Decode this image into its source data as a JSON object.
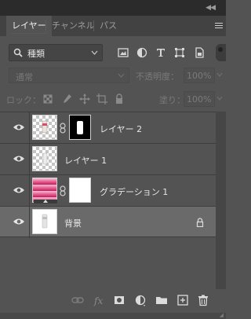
{
  "tabs": [
    {
      "label": "レイヤー",
      "active": true
    },
    {
      "label": "チャンネル",
      "active": false
    },
    {
      "label": "パス",
      "active": false
    }
  ],
  "filter": {
    "kind_label": "種類"
  },
  "blend": {
    "mode": "通常",
    "opacity_label": "不透明度：",
    "opacity_value": "100%"
  },
  "lock": {
    "label": "ロック：",
    "fill_label": "塗り：",
    "fill_value": "100%"
  },
  "layers": [
    {
      "name": "レイヤー 2",
      "thumb": "transparent",
      "has_mask": true,
      "mask": "black"
    },
    {
      "name": "レイヤー 1",
      "thumb": "transparent",
      "has_mask": false
    },
    {
      "name": "グラデーション 1",
      "thumb": "gradient",
      "has_mask": true,
      "mask": "white"
    },
    {
      "name": "背景",
      "thumb": "white",
      "locked": true,
      "selected": true
    }
  ],
  "icons": {
    "filter": [
      "image-filter-icon",
      "adjustment-filter-icon",
      "type-filter-icon",
      "shape-filter-icon",
      "smartobject-filter-icon"
    ],
    "lock": [
      "lock-transparent-icon",
      "lock-image-icon",
      "lock-position-icon",
      "lock-artboard-icon",
      "lock-all-icon"
    ],
    "bottom": [
      "link-layers-icon",
      "fx-icon",
      "add-mask-icon",
      "adjustment-layer-icon",
      "new-group-icon",
      "new-layer-icon",
      "delete-icon"
    ]
  },
  "colors": {
    "panel_bg": "#535353",
    "selected_row": "#6a6a6a",
    "tab_bar": "#424242",
    "top_strip": "#2b2b2b"
  }
}
